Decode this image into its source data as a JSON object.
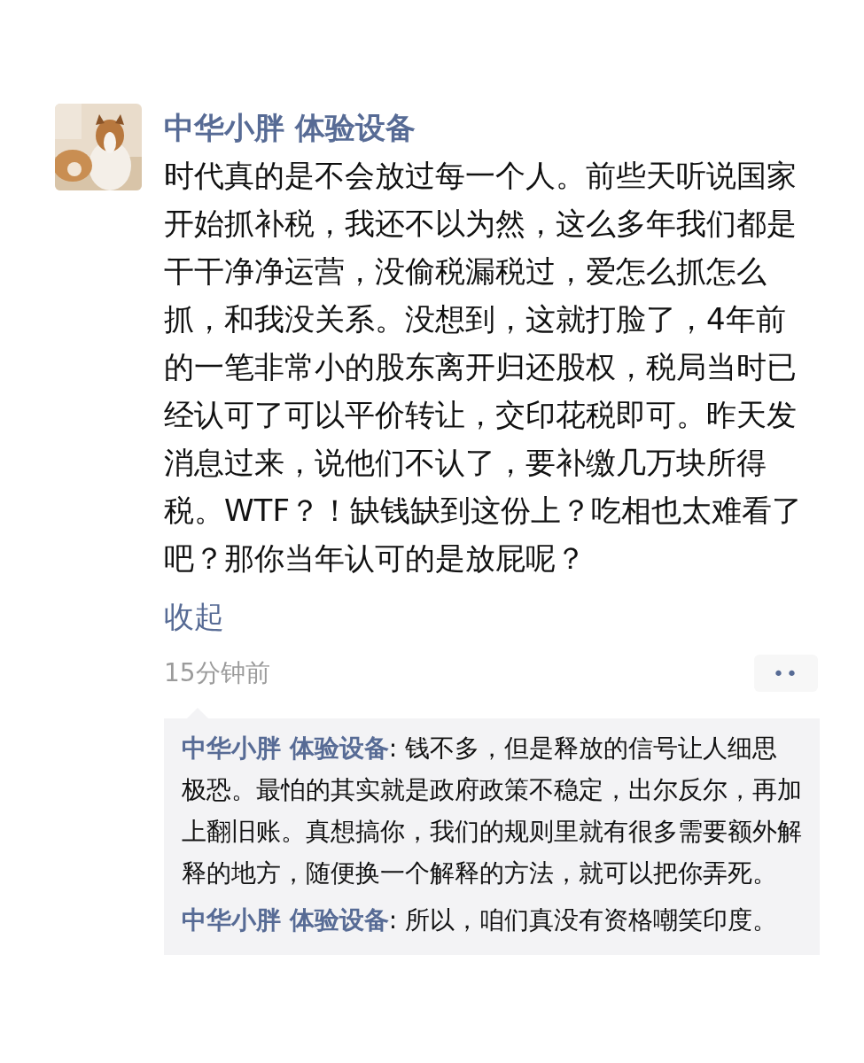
{
  "post": {
    "author": "中华小胖 体验设备",
    "text": "时代真的是不会放过每一个人。前些天听说国家开始抓补税，我还不以为然，这么多年我们都是干干净净运营，没偷税漏税过，爱怎么抓怎么抓，和我没关系。没想到，这就打脸了，4年前的一笔非常小的股东离开归还股权，税局当时已经认可了可以平价转让，交印花税即可。昨天发消息过来，说他们不认了，要补缴几万块所得税。WTF？！缺钱缺到这份上？吃相也太难看了吧？那你当年认可的是放屁呢？",
    "collapse_link": "收起",
    "time": "15分钟前",
    "more_button": "••"
  },
  "comments": [
    {
      "author": "中华小胖 体验设备",
      "separator": ": ",
      "text": "钱不多，但是释放的信号让人细思极恐。最怕的其实就是政府政策不稳定，出尔反尔，再加上翻旧账。真想搞你，我们的规则里就有很多需要额外解释的地方，随便换一个解释的方法，就可以把你弄死。"
    },
    {
      "author": "中华小胖 体验设备",
      "separator": ": ",
      "text": "所以，咱们真没有资格嘲笑印度。"
    }
  ]
}
